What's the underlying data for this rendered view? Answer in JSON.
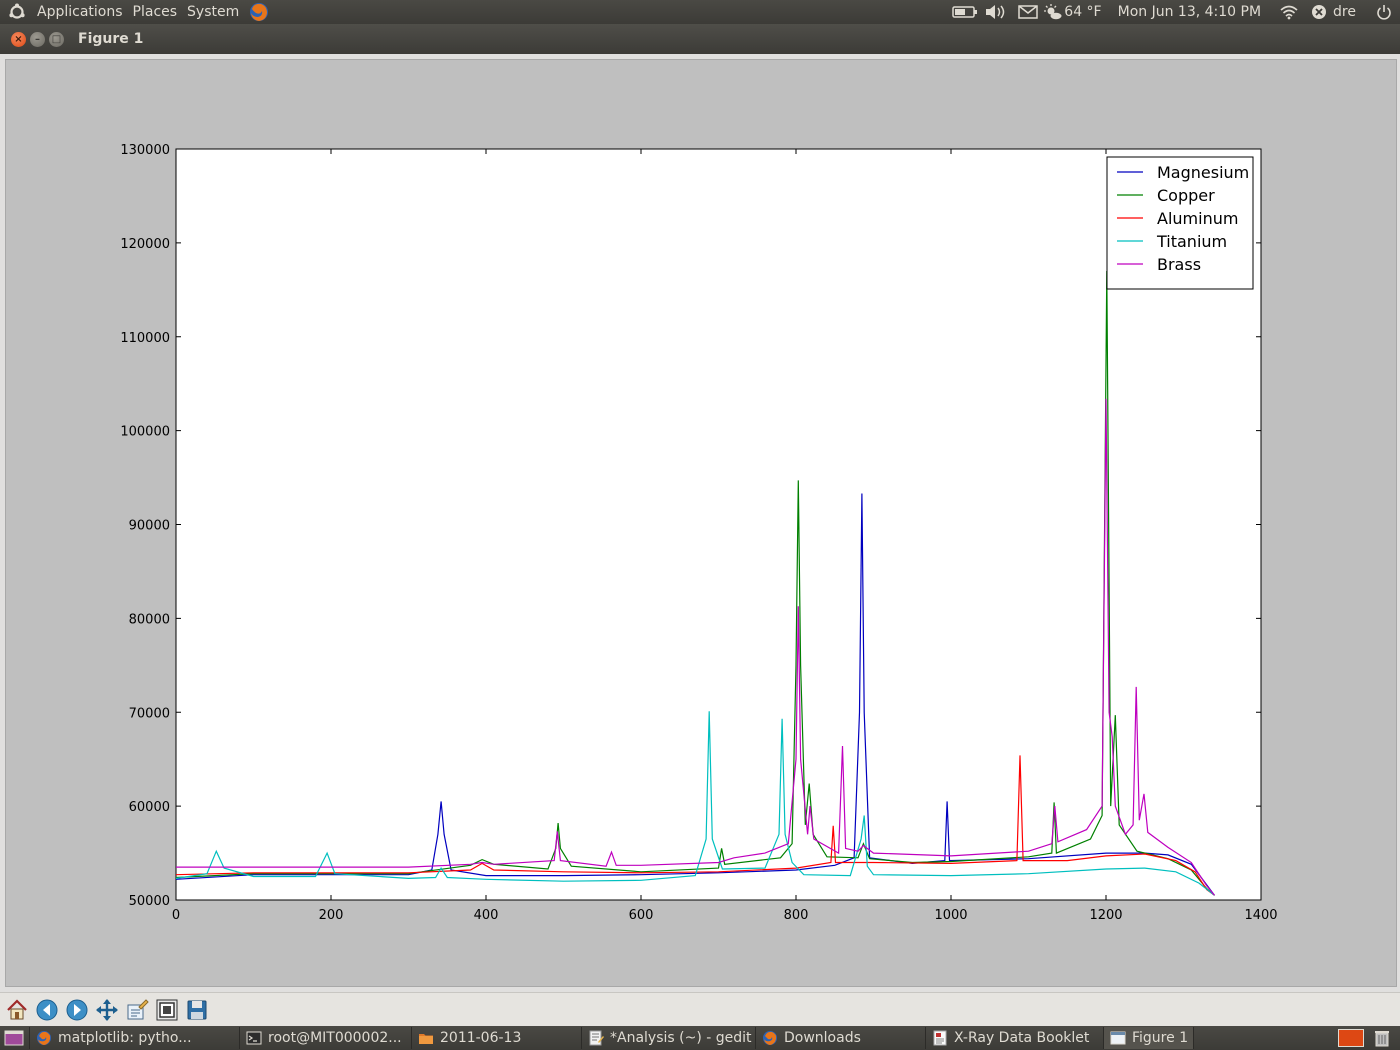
{
  "top_panel": {
    "menus": [
      "Applications",
      "Places",
      "System"
    ],
    "weather": "64 °F",
    "datetime": "Mon Jun 13,  4:10 PM",
    "user": "dre"
  },
  "window": {
    "title": "Figure 1"
  },
  "chart_data": {
    "type": "line",
    "title": "",
    "xlabel": "",
    "ylabel": "",
    "xlim": [
      0,
      1400
    ],
    "ylim": [
      50000,
      130000
    ],
    "xticks": [
      "0",
      "200",
      "400",
      "600",
      "800",
      "1000",
      "1200",
      "1400"
    ],
    "yticks": [
      "50000",
      "60000",
      "70000",
      "80000",
      "90000",
      "100000",
      "110000",
      "120000",
      "130000"
    ],
    "grid": false,
    "legend": "top-right",
    "series": [
      {
        "name": "Magnesium",
        "color": "#0000bf",
        "points": [
          [
            0,
            52200
          ],
          [
            100,
            52700
          ],
          [
            300,
            52700
          ],
          [
            330,
            53200
          ],
          [
            338,
            57000
          ],
          [
            342,
            60500
          ],
          [
            346,
            57000
          ],
          [
            355,
            53200
          ],
          [
            400,
            52600
          ],
          [
            500,
            52600
          ],
          [
            600,
            52700
          ],
          [
            700,
            52900
          ],
          [
            800,
            53200
          ],
          [
            850,
            53700
          ],
          [
            875,
            54500
          ],
          [
            882,
            70000
          ],
          [
            885,
            93300
          ],
          [
            888,
            70000
          ],
          [
            895,
            54500
          ],
          [
            950,
            53900
          ],
          [
            992,
            54200
          ],
          [
            995,
            60500
          ],
          [
            998,
            54200
          ],
          [
            1100,
            54400
          ],
          [
            1200,
            55000
          ],
          [
            1250,
            55000
          ],
          [
            1280,
            54800
          ],
          [
            1310,
            53800
          ],
          [
            1330,
            51600
          ],
          [
            1340,
            50500
          ]
        ]
      },
      {
        "name": "Copper",
        "color": "#008000",
        "points": [
          [
            0,
            52400
          ],
          [
            100,
            52800
          ],
          [
            300,
            52800
          ],
          [
            380,
            53700
          ],
          [
            395,
            54300
          ],
          [
            410,
            53800
          ],
          [
            480,
            53300
          ],
          [
            490,
            55500
          ],
          [
            493,
            58200
          ],
          [
            496,
            55500
          ],
          [
            510,
            53600
          ],
          [
            600,
            53000
          ],
          [
            700,
            53400
          ],
          [
            704,
            55500
          ],
          [
            708,
            53800
          ],
          [
            780,
            54500
          ],
          [
            795,
            56000
          ],
          [
            800,
            75000
          ],
          [
            803,
            94700
          ],
          [
            806,
            75000
          ],
          [
            812,
            58000
          ],
          [
            817,
            62400
          ],
          [
            822,
            57000
          ],
          [
            840,
            54600
          ],
          [
            880,
            54500
          ],
          [
            887,
            56000
          ],
          [
            895,
            54400
          ],
          [
            950,
            54000
          ],
          [
            1000,
            54100
          ],
          [
            1100,
            54600
          ],
          [
            1130,
            55000
          ],
          [
            1133,
            60400
          ],
          [
            1136,
            55000
          ],
          [
            1180,
            56500
          ],
          [
            1195,
            59000
          ],
          [
            1201,
            117000
          ],
          [
            1206,
            60000
          ],
          [
            1212,
            69700
          ],
          [
            1217,
            58000
          ],
          [
            1240,
            55200
          ],
          [
            1280,
            54400
          ],
          [
            1310,
            53200
          ],
          [
            1330,
            51200
          ],
          [
            1340,
            50500
          ]
        ]
      },
      {
        "name": "Aluminum",
        "color": "#ff0000",
        "points": [
          [
            0,
            52700
          ],
          [
            100,
            52900
          ],
          [
            300,
            52900
          ],
          [
            380,
            53200
          ],
          [
            395,
            53900
          ],
          [
            410,
            53200
          ],
          [
            500,
            53000
          ],
          [
            600,
            52900
          ],
          [
            700,
            53000
          ],
          [
            800,
            53400
          ],
          [
            845,
            54000
          ],
          [
            848,
            57900
          ],
          [
            851,
            54000
          ],
          [
            900,
            54000
          ],
          [
            1000,
            53900
          ],
          [
            1085,
            54200
          ],
          [
            1089,
            65400
          ],
          [
            1093,
            54200
          ],
          [
            1150,
            54200
          ],
          [
            1200,
            54700
          ],
          [
            1250,
            54900
          ],
          [
            1290,
            54200
          ],
          [
            1315,
            53000
          ],
          [
            1330,
            51100
          ],
          [
            1340,
            50500
          ]
        ]
      },
      {
        "name": "Titanium",
        "color": "#00bfbf",
        "points": [
          [
            0,
            52300
          ],
          [
            40,
            52800
          ],
          [
            52,
            55200
          ],
          [
            62,
            53400
          ],
          [
            100,
            52500
          ],
          [
            180,
            52500
          ],
          [
            195,
            55000
          ],
          [
            205,
            52800
          ],
          [
            300,
            52300
          ],
          [
            335,
            52400
          ],
          [
            342,
            53400
          ],
          [
            350,
            52400
          ],
          [
            400,
            52200
          ],
          [
            500,
            52000
          ],
          [
            600,
            52100
          ],
          [
            670,
            52600
          ],
          [
            684,
            56500
          ],
          [
            688,
            70100
          ],
          [
            692,
            56500
          ],
          [
            705,
            53300
          ],
          [
            760,
            53400
          ],
          [
            778,
            57000
          ],
          [
            782,
            69300
          ],
          [
            786,
            57000
          ],
          [
            795,
            54000
          ],
          [
            810,
            52700
          ],
          [
            870,
            52600
          ],
          [
            884,
            56500
          ],
          [
            888,
            59000
          ],
          [
            892,
            53600
          ],
          [
            900,
            52700
          ],
          [
            1000,
            52600
          ],
          [
            1100,
            52800
          ],
          [
            1200,
            53300
          ],
          [
            1250,
            53400
          ],
          [
            1290,
            53000
          ],
          [
            1320,
            51800
          ],
          [
            1340,
            50500
          ]
        ]
      },
      {
        "name": "Brass",
        "color": "#bf00bf",
        "points": [
          [
            0,
            53500
          ],
          [
            100,
            53500
          ],
          [
            300,
            53500
          ],
          [
            380,
            53800
          ],
          [
            395,
            54000
          ],
          [
            410,
            53800
          ],
          [
            488,
            54200
          ],
          [
            492,
            57300
          ],
          [
            496,
            54200
          ],
          [
            555,
            53600
          ],
          [
            562,
            55100
          ],
          [
            568,
            53700
          ],
          [
            600,
            53700
          ],
          [
            700,
            54000
          ],
          [
            720,
            54500
          ],
          [
            760,
            55000
          ],
          [
            790,
            56000
          ],
          [
            800,
            65000
          ],
          [
            803,
            81300
          ],
          [
            806,
            65000
          ],
          [
            815,
            57000
          ],
          [
            818,
            60000
          ],
          [
            823,
            56500
          ],
          [
            855,
            55000
          ],
          [
            860,
            66400
          ],
          [
            864,
            55500
          ],
          [
            880,
            55200
          ],
          [
            887,
            55800
          ],
          [
            900,
            55000
          ],
          [
            1000,
            54700
          ],
          [
            1100,
            55200
          ],
          [
            1130,
            56000
          ],
          [
            1134,
            60000
          ],
          [
            1138,
            56200
          ],
          [
            1175,
            57500
          ],
          [
            1195,
            60000
          ],
          [
            1200,
            103400
          ],
          [
            1204,
            70000
          ],
          [
            1208,
            67400
          ],
          [
            1212,
            60000
          ],
          [
            1225,
            57000
          ],
          [
            1235,
            58000
          ],
          [
            1239,
            72700
          ],
          [
            1243,
            58500
          ],
          [
            1249,
            61300
          ],
          [
            1254,
            57200
          ],
          [
            1280,
            55600
          ],
          [
            1310,
            54000
          ],
          [
            1330,
            51500
          ],
          [
            1340,
            50500
          ]
        ]
      }
    ]
  },
  "toolbar": {
    "tools": [
      "home-icon",
      "back-icon",
      "forward-icon",
      "pan-icon",
      "subplots-icon",
      "zoom-icon",
      "save-icon"
    ]
  },
  "taskbar": {
    "items": [
      {
        "label": "matplotlib: pytho...",
        "icon": "firefox-icon"
      },
      {
        "label": "root@MIT000002...",
        "icon": "terminal-icon"
      },
      {
        "label": "2011-06-13",
        "icon": "folder-icon"
      },
      {
        "label": "*Analysis (~) - gedit",
        "icon": "gedit-icon"
      },
      {
        "label": "Downloads",
        "icon": "firefox-icon"
      },
      {
        "label": "X-Ray Data Booklet",
        "icon": "document-icon"
      },
      {
        "label": "Figure 1",
        "icon": "window-icon",
        "active": true
      }
    ]
  }
}
